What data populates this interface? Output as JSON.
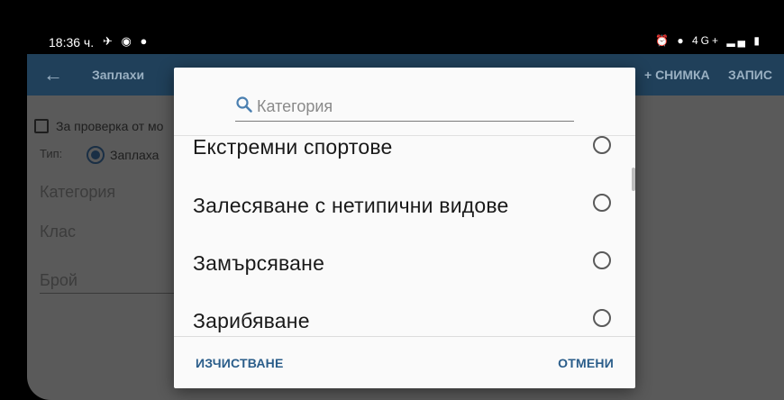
{
  "status_bar": {
    "time": "18:36 ч.",
    "left_icons": [
      "navigation-icon",
      "screen-record-icon",
      "messenger-icon"
    ],
    "right_icons": [
      "alarm-icon",
      "location-icon",
      "4g-icon",
      "signal-icon",
      "battery-icon"
    ],
    "network": "4G+"
  },
  "app_bar": {
    "title": "Заплахи",
    "action_photo": "+ СНИМКА",
    "action_save": "ЗАПИС"
  },
  "form": {
    "check_label": "За проверка от мо",
    "type_label": "Тип:",
    "type_option": "Заплаха",
    "field_category": "Категория",
    "field_class": "Клас",
    "field_count": "Брой"
  },
  "dialog": {
    "search_placeholder": "Категория",
    "options": [
      "Екстремни спортове",
      "Залесяване с нетипични видове",
      "Замърсяване",
      "Зарибяване"
    ],
    "clear_label": "ИЗЧИСТВАНЕ",
    "cancel_label": "ОТМЕНИ"
  },
  "colors": {
    "app_bar": "#20405a",
    "dialog_button": "#2a5d8a",
    "search_icon": "#4a7fb0"
  }
}
